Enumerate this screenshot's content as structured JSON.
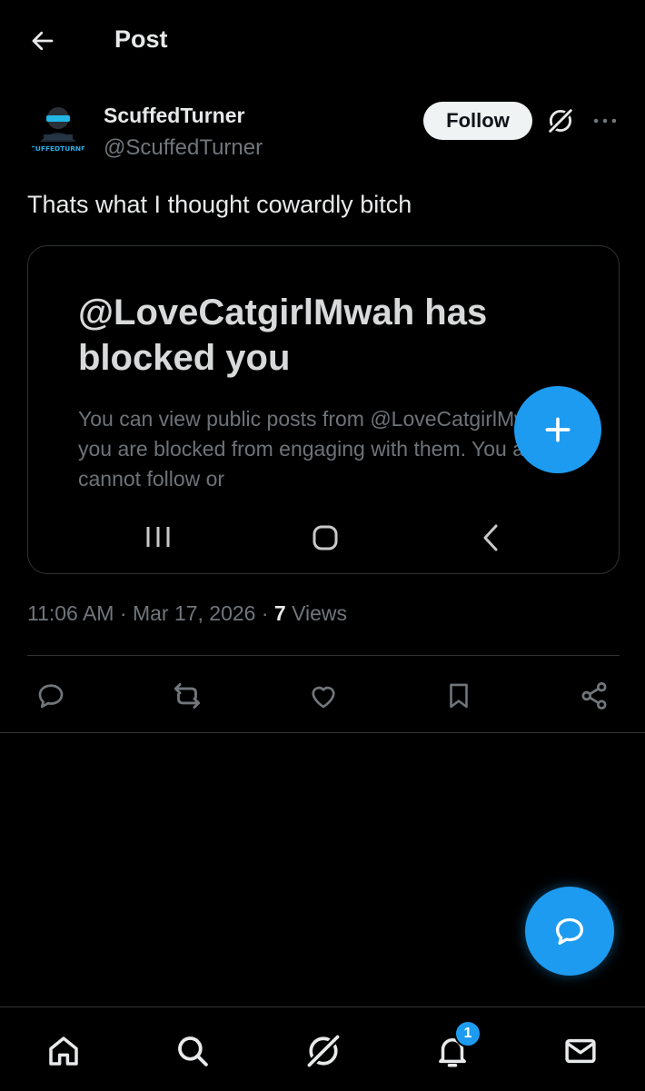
{
  "header": {
    "title": "Post",
    "back_icon": "arrow-left-icon"
  },
  "author": {
    "display_name": "ScuffedTurner",
    "handle": "@ScuffedTurner",
    "avatar_text": "SCUFFEDTURNER",
    "follow_label": "Follow"
  },
  "post": {
    "text": "Thats what I thought cowardly bitch",
    "image": {
      "title": "@LoveCatgirlMwah has blocked you",
      "body": "You can view public posts from @LoveCatgirlMwah, but you are blocked from engaging with them. You also cannot follow or"
    },
    "time": "11:06 AM",
    "date": "Mar 17, 2026",
    "views_count": "7",
    "views_label": "Views"
  },
  "actions": [
    "reply-icon",
    "repost-icon",
    "like-icon",
    "bookmark-icon",
    "share-icon"
  ],
  "bottom_nav": {
    "items": [
      "home-icon",
      "search-icon",
      "grok-icon",
      "notifications-icon",
      "messages-icon"
    ],
    "notification_badge": "1"
  },
  "colors": {
    "background": "#000000",
    "accent": "#1d9bf0",
    "text": "#e7e9ea",
    "muted": "#71767b",
    "border": "#2f3336"
  }
}
